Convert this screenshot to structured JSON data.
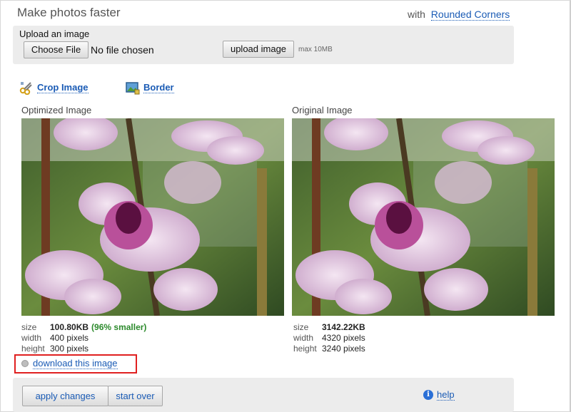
{
  "header": {
    "title": "Make photos faster",
    "with_prefix": "with",
    "with_link": "Rounded Corners"
  },
  "upload": {
    "label": "Upload an image",
    "choose_button": "Choose File",
    "no_file": "No file chosen",
    "upload_button": "upload image",
    "max_size": "max 10MB"
  },
  "tools": {
    "crop_label": "Crop Image",
    "crop_icon": "crop-scissors-icon",
    "border_label": "Border",
    "border_icon": "border-picture-icon"
  },
  "optimized": {
    "label": "Optimized Image",
    "size_key": "size",
    "size_value": "100.80KB",
    "smaller_text": "(96% smaller)",
    "width_key": "width",
    "width_value": "400 pixels",
    "height_key": "height",
    "height_value": "300 pixels"
  },
  "original": {
    "label": "Original Image",
    "size_key": "size",
    "size_value": "3142.22KB",
    "width_key": "width",
    "width_value": "4320 pixels",
    "height_key": "height",
    "height_value": "3240 pixels"
  },
  "download": {
    "label": "download this image"
  },
  "footer": {
    "apply_button": "apply changes",
    "start_over_button": "start over",
    "help_label": "help",
    "help_icon_glyph": "i"
  },
  "colors": {
    "link": "#1a5bb5",
    "smaller_green": "#2c8a2c",
    "highlight_red": "#e02020",
    "panel_bg": "#ececec"
  }
}
